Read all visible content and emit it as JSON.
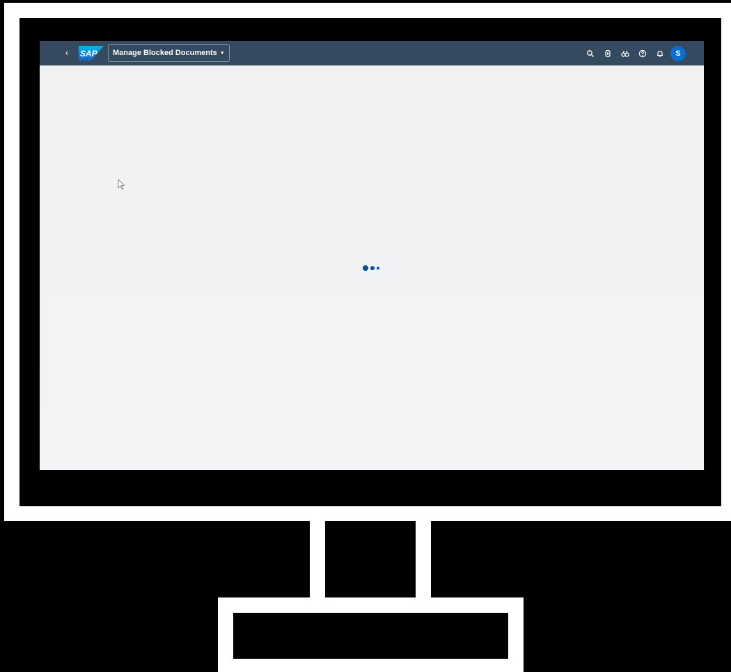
{
  "shell": {
    "back_glyph": "‹",
    "logo_text": "SAP",
    "app_title": "Manage Blocked Documents",
    "caret": "▼",
    "actions": [
      "search-icon",
      "co-pilot-icon",
      "binoculars-icon",
      "help-icon",
      "bell-icon"
    ],
    "user_initial": "S"
  },
  "content": {
    "state": "loading"
  },
  "colors": {
    "shellbar": "#354a5f",
    "canvas": "#f2f3f4",
    "accent": "#0a6ed1",
    "busy_indicator": "#0a4f9c"
  }
}
